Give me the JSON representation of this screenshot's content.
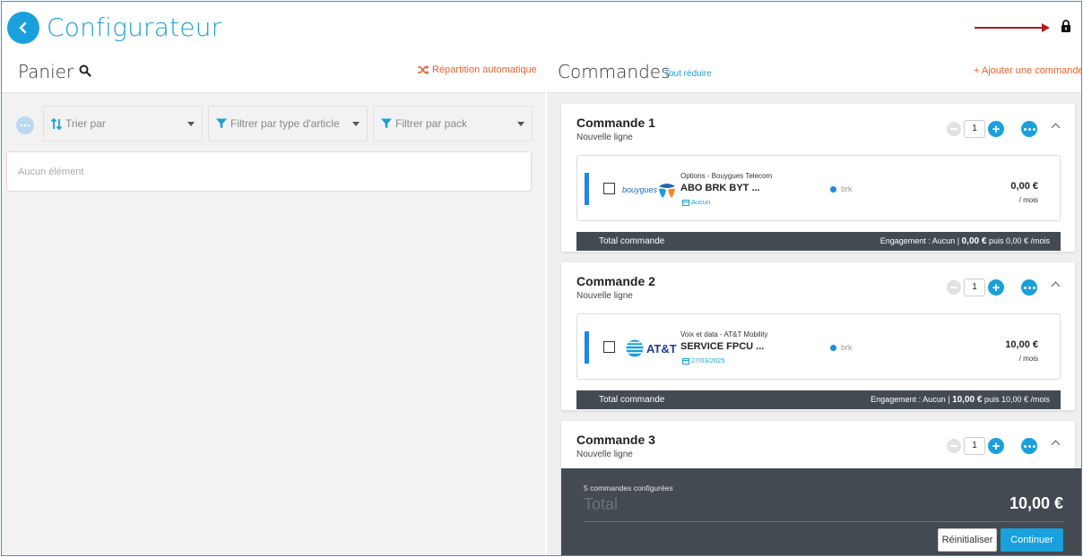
{
  "header": {
    "title": "Configurateur"
  },
  "panier": {
    "title": "Panier",
    "repartition_label": "Répartition automatique",
    "filters": {
      "sort_label": "Trier par",
      "type_label": "Filtrer par type d'article",
      "pack_label": "Filtrer par pack"
    },
    "empty_text": "Aucun élément"
  },
  "commandes": {
    "title": "Commandes",
    "collapse_all_label": "Tout réduire",
    "add_label": "+ Ajouter une commande",
    "items": [
      {
        "title": "Commande 1",
        "subtitle": "Nouvelle ligne",
        "quantity": "1",
        "line": {
          "brand": "bouygues",
          "category": "Options - Bouygues Telecom",
          "name": "ABO BRK BYT ...",
          "date": "Aucun",
          "tag": "brk",
          "price": "0,00 €",
          "period": "/ mois"
        },
        "total": {
          "label": "Total commande",
          "prefix": "Engagement : Aucun |",
          "amount": "0,00 €",
          "suffix": "puis 0,00 € /mois"
        }
      },
      {
        "title": "Commande 2",
        "subtitle": "Nouvelle ligne",
        "quantity": "1",
        "line": {
          "brand": "AT&T",
          "category": "Voix et data - AT&T Mobility",
          "name": "SERVICE FPCU ...",
          "date": "27/03/2025",
          "tag": "brk",
          "price": "10,00 €",
          "period": "/ mois"
        },
        "total": {
          "label": "Total commande",
          "prefix": "Engagement : Aucun |",
          "amount": "10,00 €",
          "suffix": "puis 10,00 € /mois"
        }
      },
      {
        "title": "Commande 3",
        "subtitle": "Nouvelle ligne",
        "quantity": "1"
      }
    ]
  },
  "summary": {
    "count_text": "5 commandes configurées",
    "total_label": "Total",
    "total_value": "10,00 €",
    "reset_label": "Réinitialiser",
    "continue_label": "Continuer"
  },
  "colors": {
    "primary": "#1aa0dc",
    "accent": "#e8602c",
    "dark": "#434a52",
    "annotation_arrow": "#b31b1b"
  },
  "icons": {
    "back": "chevron-left-icon",
    "lock": "lock-icon",
    "search": "search-icon",
    "shuffle": "shuffle-icon",
    "sort": "sort-icon",
    "filter": "filter-icon",
    "more": "more-dots-icon",
    "calendar": "calendar-icon"
  }
}
